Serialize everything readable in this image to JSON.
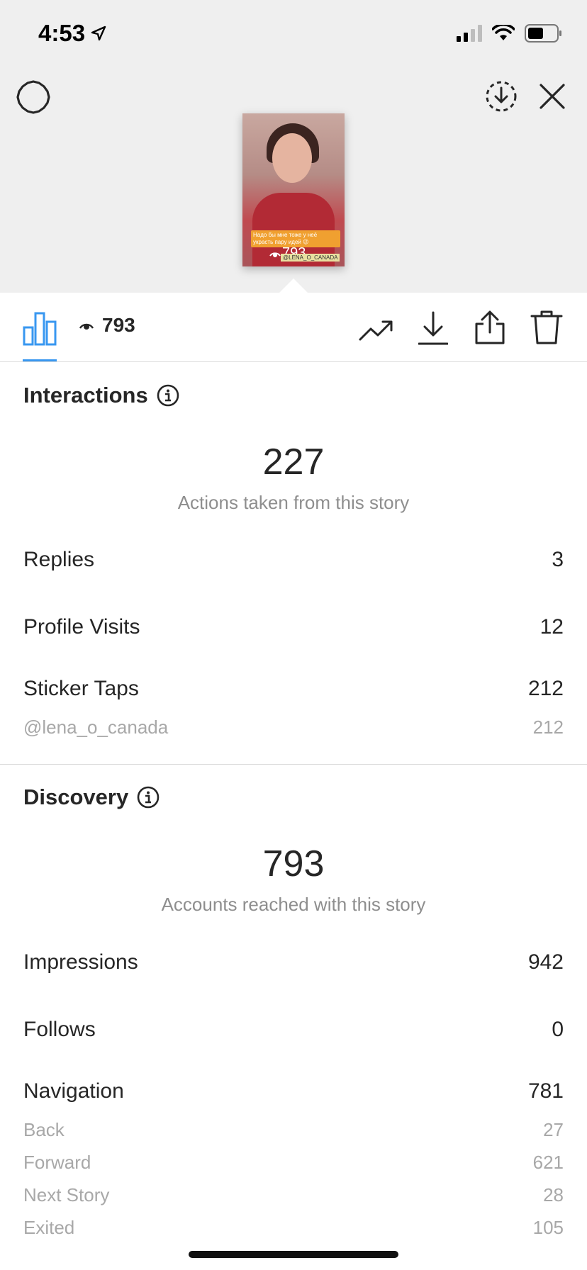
{
  "status": {
    "time": "4:53"
  },
  "story": {
    "caption": "Надо бы мне тоже у неё украсть пару идей 😉",
    "mention_sticker": "@LENA_O_CANADA",
    "views": "793"
  },
  "toolbar": {
    "views": "793"
  },
  "interactions": {
    "title": "Interactions",
    "total": "227",
    "total_label": "Actions taken from this story",
    "rows": [
      {
        "label": "Replies",
        "value": "3"
      },
      {
        "label": "Profile Visits",
        "value": "12"
      },
      {
        "label": "Sticker Taps",
        "value": "212"
      }
    ],
    "sticker_detail": {
      "label": "@lena_o_canada",
      "value": "212"
    }
  },
  "discovery": {
    "title": "Discovery",
    "total": "793",
    "total_label": "Accounts reached with this story",
    "rows": [
      {
        "label": "Impressions",
        "value": "942"
      },
      {
        "label": "Follows",
        "value": "0"
      },
      {
        "label": "Navigation",
        "value": "781"
      }
    ],
    "navigation_detail": [
      {
        "label": "Back",
        "value": "27"
      },
      {
        "label": "Forward",
        "value": "621"
      },
      {
        "label": "Next Story",
        "value": "28"
      },
      {
        "label": "Exited",
        "value": "105"
      }
    ]
  }
}
